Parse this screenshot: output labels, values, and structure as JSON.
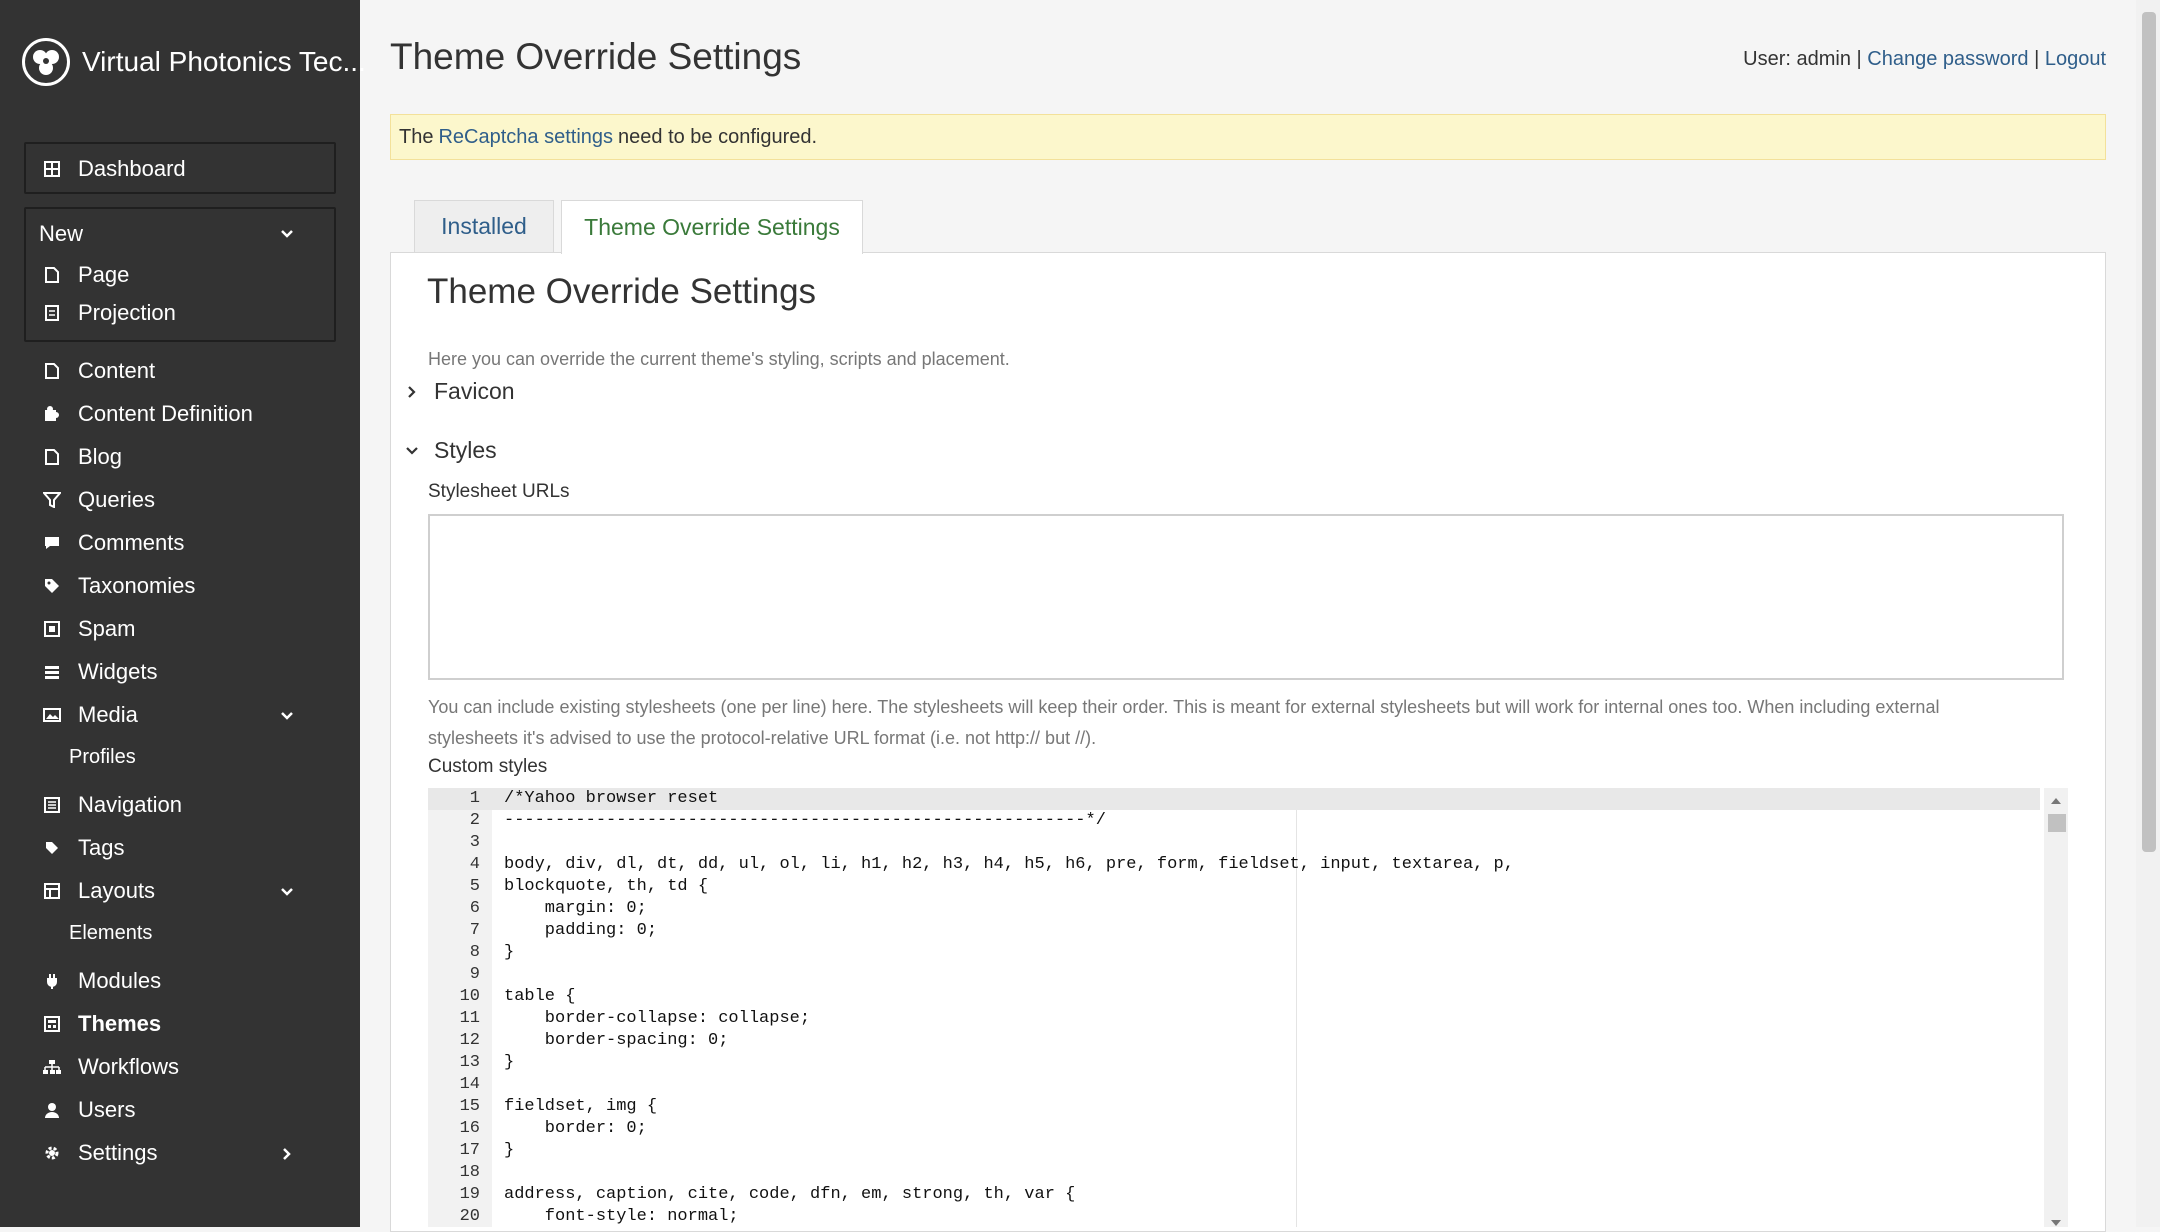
{
  "brand": {
    "name": "Virtual Photonics Tec..."
  },
  "header": {
    "title": "Theme Override Settings",
    "user_prefix": "User: admin",
    "separator": "|",
    "change_password": "Change password",
    "logout": "Logout"
  },
  "alert": {
    "pre": "The",
    "link": "ReCaptcha settings",
    "post": "need to be configured."
  },
  "sidebar": {
    "dashboard": "Dashboard",
    "new": {
      "label": "New",
      "items": [
        "Page",
        "Projection"
      ]
    },
    "items": {
      "content": "Content",
      "content_definition": "Content Definition",
      "blog": "Blog",
      "queries": "Queries",
      "comments": "Comments",
      "taxonomies": "Taxonomies",
      "spam": "Spam",
      "widgets": "Widgets",
      "media": "Media",
      "profiles": "Profiles",
      "navigation": "Navigation",
      "tags": "Tags",
      "layouts": "Layouts",
      "elements": "Elements",
      "modules": "Modules",
      "themes": "Themes",
      "workflows": "Workflows",
      "users": "Users",
      "settings": "Settings"
    }
  },
  "tabs": {
    "installed": "Installed",
    "override": "Theme Override Settings"
  },
  "panel": {
    "title": "Theme Override Settings",
    "intro": "Here you can override the current theme's styling, scripts and placement.",
    "favicon": "Favicon",
    "styles": "Styles",
    "stylesheet_label": "Stylesheet URLs",
    "stylesheet_value": "",
    "help": "You can include existing stylesheets (one per line) here. The stylesheets will keep their order. This is meant for external stylesheets but will work for internal ones too. When including external stylesheets it's advised to use the protocol-relative URL format (i.e. not http:// but //).",
    "custom_label": "Custom styles"
  },
  "code_lines": [
    "/*Yahoo browser reset",
    "---------------------------------------------------------*/",
    "",
    "body, div, dl, dt, dd, ul, ol, li, h1, h2, h3, h4, h5, h6, pre, form, fieldset, input, textarea, p,",
    "blockquote, th, td {",
    "    margin: 0;",
    "    padding: 0;",
    "}",
    "",
    "table {",
    "    border-collapse: collapse;",
    "    border-spacing: 0;",
    "}",
    "",
    "fieldset, img {",
    "    border: 0;",
    "}",
    "",
    "address, caption, cite, code, dfn, em, strong, th, var {",
    "    font-style: normal;"
  ]
}
